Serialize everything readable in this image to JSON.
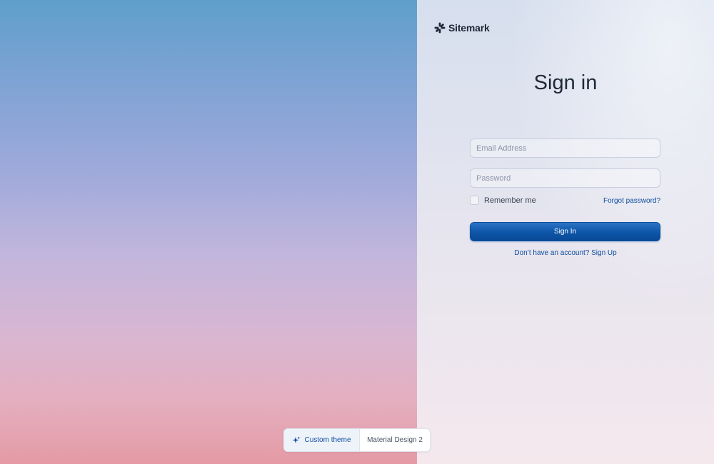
{
  "brand": {
    "name": "Sitemark",
    "icon": "sitemark-logo-icon"
  },
  "theme_toggle": {
    "icon": "moon-icon"
  },
  "signin": {
    "title": "Sign in",
    "email_placeholder": "Email Address",
    "password_placeholder": "Password",
    "remember_label": "Remember me",
    "forgot_label": "Forgot password?",
    "submit_label": "Sign In",
    "signup_label": "Don’t have an account? Sign Up"
  },
  "theme_switcher": {
    "options": [
      {
        "label": "Custom theme",
        "icon": "sparkle-icon",
        "selected": true
      },
      {
        "label": "Material Design 2",
        "selected": false
      }
    ]
  },
  "colors": {
    "accent": "#0d55a8",
    "link": "#0b4c9c",
    "text": "#1f2937"
  }
}
